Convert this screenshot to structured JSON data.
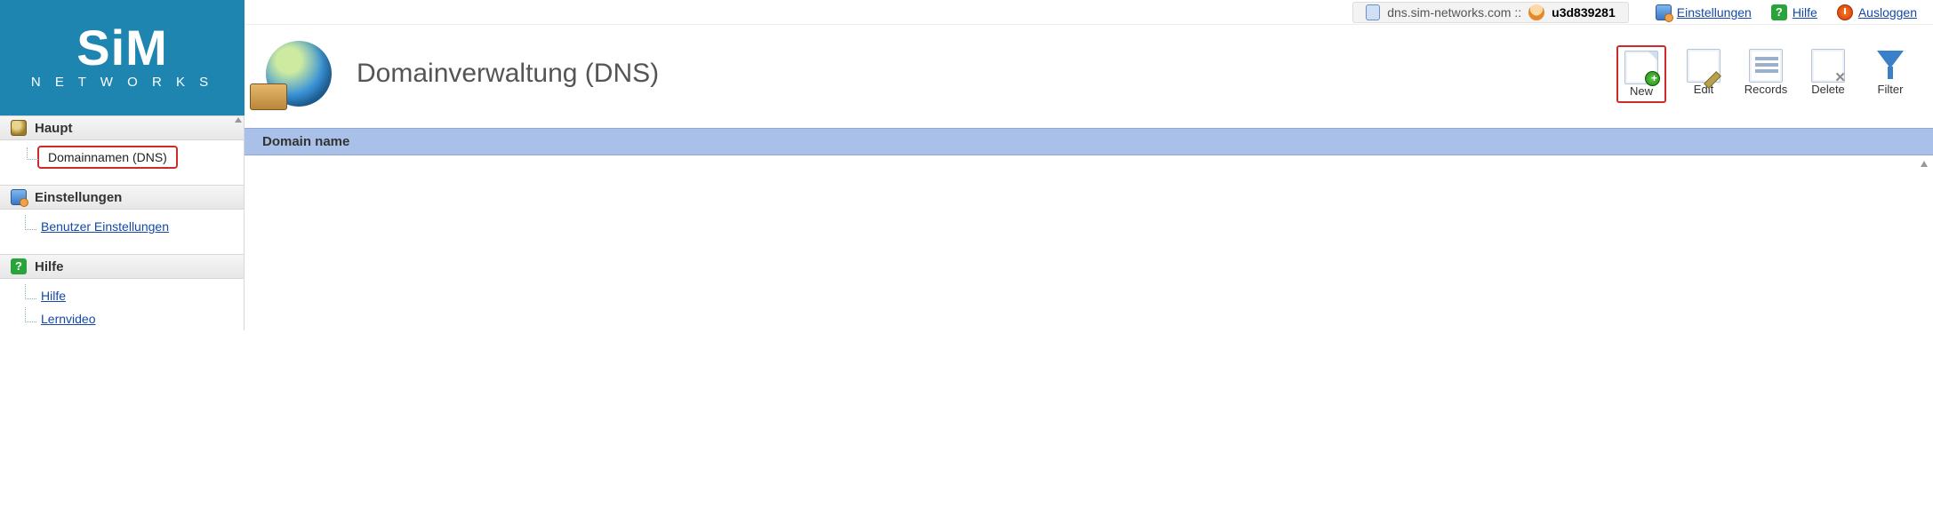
{
  "brand": {
    "name": "SiM",
    "sub": "N E T W O R K S"
  },
  "crumb": {
    "host": "dns.sim-networks.com ::",
    "user": "u3d839281"
  },
  "toplinks": {
    "settings": "Einstellungen",
    "help": "Hilfe",
    "logout": "Ausloggen"
  },
  "header": {
    "title": "Domainverwaltung (DNS)"
  },
  "toolbar": {
    "new": "New",
    "edit": "Edit",
    "records": "Records",
    "delete": "Delete",
    "filter": "Filter"
  },
  "table": {
    "col_domain": "Domain name"
  },
  "nav": {
    "haupt": {
      "label": "Haupt",
      "items": {
        "dns": "Domainnamen (DNS)"
      }
    },
    "einstellungen": {
      "label": "Einstellungen",
      "items": {
        "user_settings": "Benutzer Einstellungen"
      }
    },
    "hilfe": {
      "label": "Hilfe",
      "items": {
        "help": "Hilfe",
        "video": "Lernvideo"
      }
    }
  }
}
